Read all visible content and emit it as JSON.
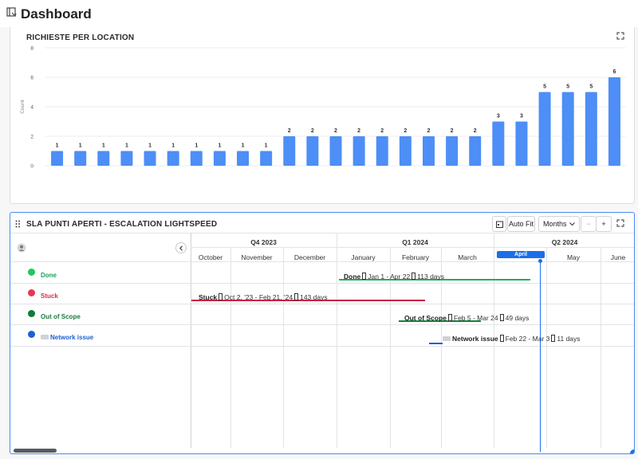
{
  "app": {
    "title": "Dashboard",
    "icon": "dashboard-icon"
  },
  "chart_panel": {
    "title": "RICHIESTE PER LOCATION",
    "expand_icon": "expand-icon"
  },
  "chart_data": {
    "type": "bar",
    "title": "RICHIESTE PER LOCATION",
    "ylabel": "Count",
    "xlabel": "",
    "ylim": [
      0,
      8
    ],
    "yticks": [
      0,
      2,
      4,
      6,
      8
    ],
    "values": [
      1,
      1,
      1,
      1,
      1,
      1,
      1,
      1,
      1,
      1,
      2,
      2,
      2,
      2,
      2,
      2,
      2,
      2,
      2,
      3,
      3,
      5,
      5,
      5,
      6
    ],
    "bar_color": "#4d8ef7",
    "grid": true
  },
  "gantt_panel": {
    "title": "SLA PUNTI APERTI - ESCALATION LIGHTSPEED",
    "drag_icon": "drag-handle-icon",
    "toolbar": {
      "calendar_icon": "calendar-icon",
      "autofit_label": "Auto Fit",
      "scale_value": "Months",
      "zoom_out": "−",
      "zoom_in": "+",
      "expand_icon": "expand-icon"
    },
    "collapse_icon": "chevron-left-icon",
    "avatar_icon": "avatar-icon",
    "quarters": [
      "Q4 2023",
      "Q1 2024",
      "Q2 2024"
    ],
    "months": [
      "October",
      "November",
      "December",
      "January",
      "February",
      "March",
      "April",
      "May",
      "June"
    ],
    "today_label": "April",
    "rows": [
      {
        "label": "Done",
        "color": "#1aa35a",
        "dot": "#22c55e"
      },
      {
        "label": "Stuck",
        "color": "#d62d4a",
        "dot": "#e23a50"
      },
      {
        "label": "Out of Scope",
        "color": "#1a7a3a",
        "dot": "#117a36"
      },
      {
        "label": "Network issue",
        "color": "#1b5fd6",
        "dot": "#1b5fd6"
      }
    ],
    "bars": [
      {
        "name": "Done",
        "dates": "Jan 1 - Apr 22",
        "days": "113 days",
        "color": "#1fae5e"
      },
      {
        "name": "Stuck",
        "dates": "Oct 2, '23 - Feb 21, '24",
        "days": "143 days",
        "color": "#c7243f"
      },
      {
        "name": "Out of Scope",
        "dates": "Feb 5 - Mar 24",
        "days": "49 days",
        "color": "#16803b"
      },
      {
        "name": "Network issue",
        "dates": "Feb 22 - Mar 3",
        "days": "11 days",
        "color": "#1b5fd6"
      }
    ]
  }
}
